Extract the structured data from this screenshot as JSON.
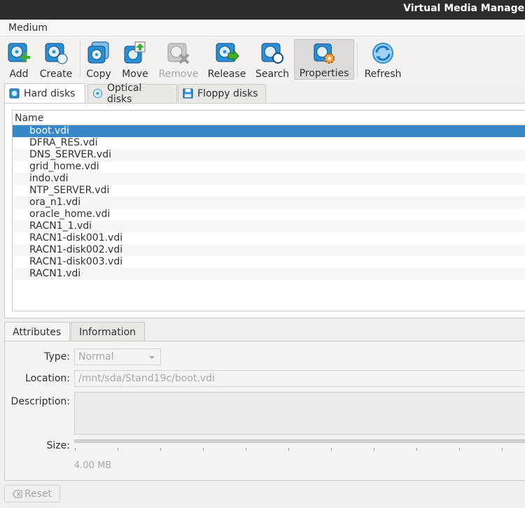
{
  "window": {
    "title": "Virtual Media Manager"
  },
  "menu": {
    "medium": "Medium"
  },
  "toolbar": {
    "buttons": [
      {
        "label": "Add",
        "icon": "add-disk-icon",
        "state": "enabled"
      },
      {
        "label": "Create",
        "icon": "create-disk-icon",
        "state": "enabled"
      },
      {
        "label": "Copy",
        "icon": "copy-disk-icon",
        "state": "enabled"
      },
      {
        "label": "Move",
        "icon": "move-disk-icon",
        "state": "enabled"
      },
      {
        "label": "Remove",
        "icon": "remove-disk-icon",
        "state": "disabled"
      },
      {
        "label": "Release",
        "icon": "release-disk-icon",
        "state": "enabled"
      },
      {
        "label": "Search",
        "icon": "search-disk-icon",
        "state": "enabled"
      },
      {
        "label": "Properties",
        "icon": "properties-disk-icon",
        "state": "active"
      },
      {
        "label": "Refresh",
        "icon": "refresh-icon",
        "state": "enabled"
      }
    ]
  },
  "media_tabs": [
    {
      "label": "Hard disks",
      "icon": "hard-disk-icon",
      "selected": true
    },
    {
      "label": "Optical disks",
      "icon": "optical-disk-icon",
      "selected": false
    },
    {
      "label": "Floppy disks",
      "icon": "floppy-disk-icon",
      "selected": false
    }
  ],
  "list": {
    "column_header": "Name",
    "items": [
      "boot.vdi",
      "DFRA_RES.vdi",
      "DNS_SERVER.vdi",
      "grid_home.vdi",
      "indo.vdi",
      "NTP_SERVER.vdi",
      "ora_n1.vdi",
      "oracle_home.vdi",
      "RACN1_1.vdi",
      "RACN1-disk001.vdi",
      "RACN1-disk002.vdi",
      "RACN1-disk003.vdi",
      "RACN1.vdi"
    ],
    "selected_index": 0
  },
  "detail_tabs": [
    {
      "label": "Attributes",
      "selected": true
    },
    {
      "label": "Information",
      "selected": false
    }
  ],
  "attributes": {
    "type_label": "Type:",
    "type_value": "Normal",
    "location_label": "Location:",
    "location_value": "/mnt/sda/Stand19c/boot.vdi",
    "description_label": "Description:",
    "description_value": "",
    "size_label": "Size:",
    "size_value": "4.00 MB"
  },
  "buttons": {
    "reset": "Reset"
  },
  "colors": {
    "selection": "#3a87c8",
    "titlebar": "#2c2c2c",
    "icon_blue": "#2b8fd6"
  }
}
